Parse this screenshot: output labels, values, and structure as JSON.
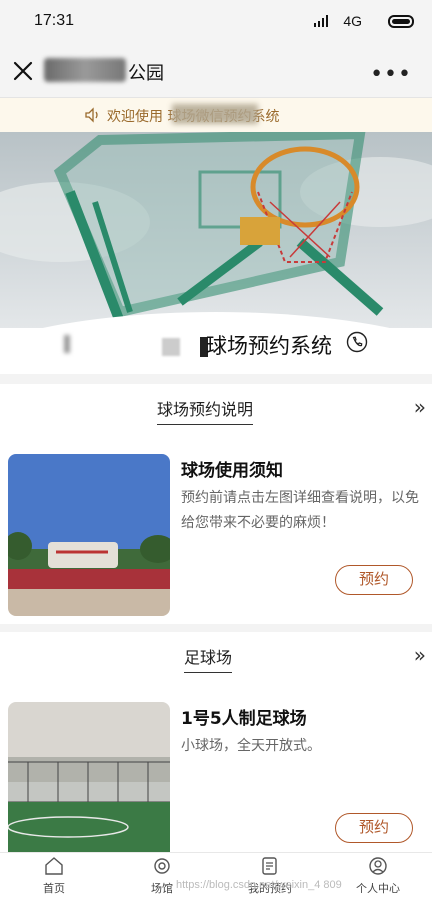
{
  "status_bar": {
    "time": "17:31",
    "network": "4G"
  },
  "nav": {
    "title": "公园"
  },
  "notice": {
    "text": "欢迎使用 球场微信预约系统"
  },
  "hero": {
    "system_title": "球场预约系统"
  },
  "sections": [
    {
      "title": "球场预约说明",
      "card": {
        "title": "球场使用须知",
        "desc": "预约前请点击左图详细查看说明，以免给您带来不必要的麻烦！",
        "button": "预约"
      }
    },
    {
      "title": "足球场",
      "card": {
        "title": "1号5人制足球场",
        "desc": "小球场，全天开放式。",
        "button": "预约"
      }
    }
  ],
  "tabbar": {
    "items": [
      {
        "label": "首页",
        "icon": "home-icon"
      },
      {
        "label": "场馆",
        "icon": "venue-icon"
      },
      {
        "label": "我的预约",
        "icon": "reservation-icon"
      },
      {
        "label": "个人中心",
        "icon": "profile-icon"
      }
    ]
  },
  "watermark": "https://blog.csdn.net/weixin_4   809"
}
